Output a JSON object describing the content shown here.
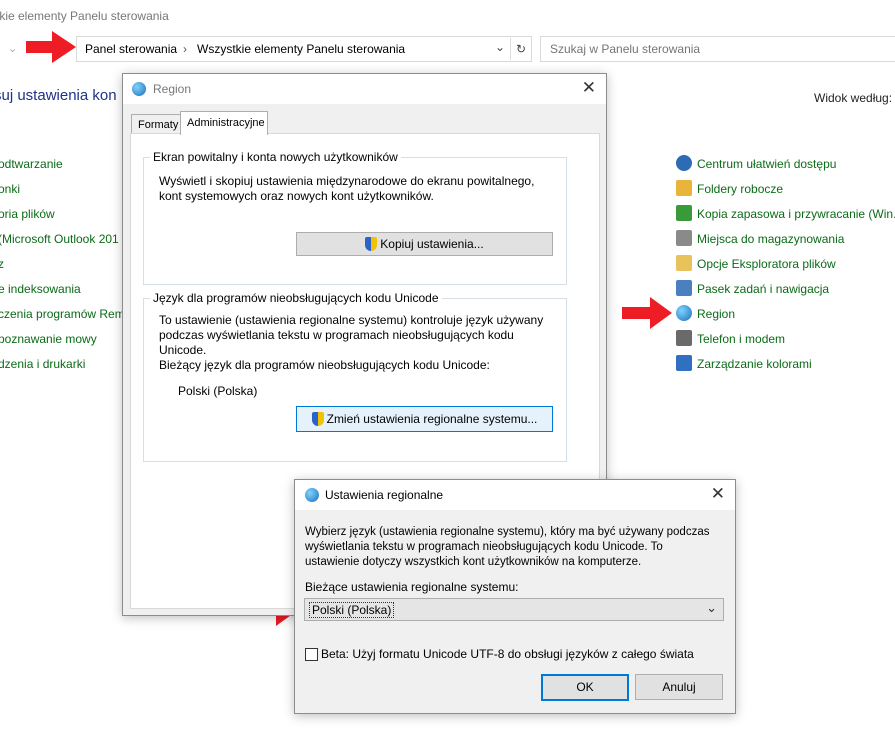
{
  "control_panel": {
    "window_title": "tkie elementy Panelu sterowania",
    "breadcrumb": [
      "Panel sterowania",
      "Wszystkie elementy Panelu sterowania"
    ],
    "search_placeholder": "Szukaj w Panelu sterowania",
    "heading": "suj ustawienia kon",
    "view_by": "Widok według:",
    "left_items": [
      "odtwarzanie",
      "onki",
      "oria plików",
      "(Microsoft Outlook 201",
      "z",
      "e indeksowania",
      "czenia programów Rem",
      "poznawanie mowy",
      "dzenia i drukarki"
    ],
    "right_items": [
      {
        "label": "Centrum ułatwień dostępu",
        "icon": "accessibility-icon",
        "color": "#2d6bb5"
      },
      {
        "label": "Foldery robocze",
        "icon": "work-folders-icon",
        "color": "#e8b53a"
      },
      {
        "label": "Kopia zapasowa i przywracanie (Win...",
        "icon": "backup-icon",
        "color": "#3a9a3a"
      },
      {
        "label": "Miejsca do magazynowania",
        "icon": "storage-spaces-icon",
        "color": "#8a8a8a"
      },
      {
        "label": "Opcje Eksploratora plików",
        "icon": "explorer-options-icon",
        "color": "#e8c25a"
      },
      {
        "label": "Pasek zadań i nawigacja",
        "icon": "taskbar-icon",
        "color": "#4a7fc0"
      },
      {
        "label": "Region",
        "icon": "region-globe-icon",
        "color": "#1c8fd6"
      },
      {
        "label": "Telefon i modem",
        "icon": "phone-modem-icon",
        "color": "#6a6a6a"
      },
      {
        "label": "Zarządzanie kolorami",
        "icon": "color-management-icon",
        "color": "#3070c0"
      }
    ]
  },
  "region_dialog": {
    "title": "Region",
    "tabs": [
      "Formaty",
      "Administracyjne"
    ],
    "group1": {
      "legend": "Ekran powitalny i konta nowych użytkowników",
      "text_lines": [
        "Wyświetl i skopiuj ustawienia międzynarodowe do ekranu powitalnego,",
        "kont systemowych oraz nowych kont użytkowników."
      ],
      "button": "Kopiuj ustawienia..."
    },
    "group2": {
      "legend": "Język dla programów nieobsługujących kodu Unicode",
      "text_lines": [
        "To ustawienie (ustawienia regionalne systemu) kontroluje język używany",
        "podczas wyświetlania tekstu w programach nieobsługujących kodu",
        "Unicode."
      ],
      "current_label": "Bieżący język dla programów nieobsługujących kodu Unicode:",
      "current_value": "Polski (Polska)",
      "button": "Zmień ustawienia regionalne systemu..."
    }
  },
  "locale_dialog": {
    "title": "Ustawienia regionalne",
    "text_lines": [
      "Wybierz język (ustawienia regionalne systemu), który ma być używany podczas",
      "wyświetlania tekstu w programach nieobsługujących kodu Unicode. To",
      "ustawienie dotyczy wszystkich kont użytkowników na komputerze."
    ],
    "current_label": "Bieżące ustawienia regionalne systemu:",
    "selected_locale": "Polski (Polska)",
    "beta_checkbox": "Beta: Użyj formatu Unicode UTF-8 do obsługi języków z całego świata",
    "ok": "OK",
    "cancel": "Anuluj"
  },
  "accent_color": "#ee1c25"
}
